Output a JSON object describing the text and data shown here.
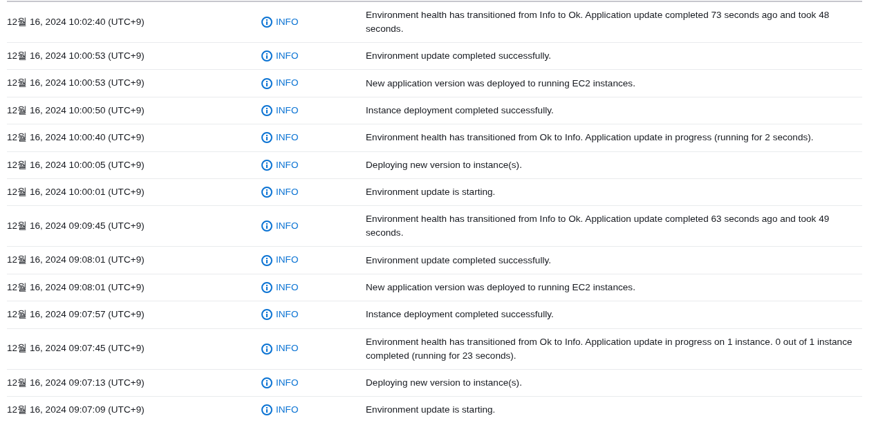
{
  "events": [
    {
      "time": "12월 16, 2024 10:02:40 (UTC+9)",
      "type": "INFO",
      "message": "Environment health has transitioned from Info to Ok. Application update completed 73 seconds ago and took 48 seconds."
    },
    {
      "time": "12월 16, 2024 10:00:53 (UTC+9)",
      "type": "INFO",
      "message": "Environment update completed successfully."
    },
    {
      "time": "12월 16, 2024 10:00:53 (UTC+9)",
      "type": "INFO",
      "message": "New application version was deployed to running EC2 instances."
    },
    {
      "time": "12월 16, 2024 10:00:50 (UTC+9)",
      "type": "INFO",
      "message": "Instance deployment completed successfully."
    },
    {
      "time": "12월 16, 2024 10:00:40 (UTC+9)",
      "type": "INFO",
      "message": "Environment health has transitioned from Ok to Info. Application update in progress (running for 2 seconds)."
    },
    {
      "time": "12월 16, 2024 10:00:05 (UTC+9)",
      "type": "INFO",
      "message": "Deploying new version to instance(s)."
    },
    {
      "time": "12월 16, 2024 10:00:01 (UTC+9)",
      "type": "INFO",
      "message": "Environment update is starting."
    },
    {
      "time": "12월 16, 2024 09:09:45 (UTC+9)",
      "type": "INFO",
      "message": "Environment health has transitioned from Info to Ok. Application update completed 63 seconds ago and took 49 seconds."
    },
    {
      "time": "12월 16, 2024 09:08:01 (UTC+9)",
      "type": "INFO",
      "message": "Environment update completed successfully."
    },
    {
      "time": "12월 16, 2024 09:08:01 (UTC+9)",
      "type": "INFO",
      "message": "New application version was deployed to running EC2 instances."
    },
    {
      "time": "12월 16, 2024 09:07:57 (UTC+9)",
      "type": "INFO",
      "message": "Instance deployment completed successfully."
    },
    {
      "time": "12월 16, 2024 09:07:45 (UTC+9)",
      "type": "INFO",
      "message": "Environment health has transitioned from Ok to Info. Application update in progress on 1 instance. 0 out of 1 instance completed (running for 23 seconds)."
    },
    {
      "time": "12월 16, 2024 09:07:13 (UTC+9)",
      "type": "INFO",
      "message": "Deploying new version to instance(s)."
    },
    {
      "time": "12월 16, 2024 09:07:09 (UTC+9)",
      "type": "INFO",
      "message": "Environment update is starting."
    }
  ]
}
